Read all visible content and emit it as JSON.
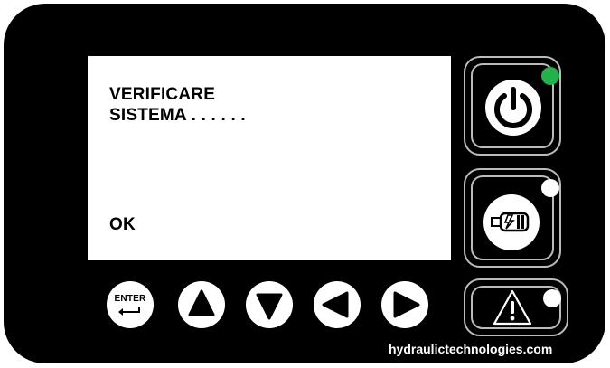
{
  "display": {
    "line1": "VERIFICARE",
    "line2": "SISTEMA . . . . . .",
    "line3": "OK"
  },
  "buttons": {
    "enter_label": "ENTER"
  },
  "indicators": {
    "power_led_color": "#22b14c",
    "motor_led_color": "#ffffff",
    "alarm_led_color": "#ffffff"
  },
  "icons": {
    "power": "power-icon",
    "motor": "motor-icon",
    "alarm": "warning-icon",
    "up": "arrow-up-icon",
    "down": "arrow-down-icon",
    "left": "arrow-left-icon",
    "right": "arrow-right-icon",
    "enter": "enter-icon"
  },
  "brand": {
    "website": "hydraulictechnologies.com"
  }
}
